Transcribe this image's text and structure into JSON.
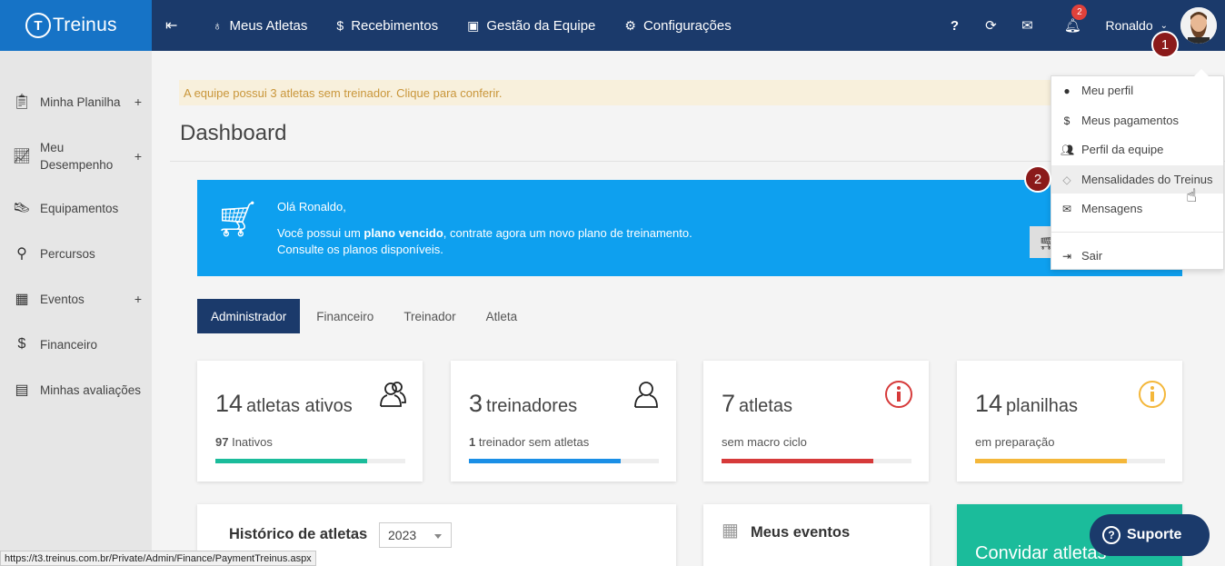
{
  "topbar": {
    "brand": "Treinus",
    "nav": [
      {
        "icon": "medal-icon",
        "label": "Meus Atletas"
      },
      {
        "icon": "dollar-icon",
        "label": "Recebimentos"
      },
      {
        "icon": "id-card-icon",
        "label": "Gestão da Equipe"
      },
      {
        "icon": "gears-icon",
        "label": "Configurações"
      }
    ],
    "help": "?",
    "notifications_count": "2",
    "user_name": "Ronaldo"
  },
  "sidebar": {
    "items": [
      {
        "label": "Minha Planilha",
        "plus": "+"
      },
      {
        "label": "Meu Desempenho",
        "plus": "+"
      },
      {
        "label": "Equipamentos",
        "plus": ""
      },
      {
        "label": "Percursos",
        "plus": ""
      },
      {
        "label": "Eventos",
        "plus": "+"
      },
      {
        "label": "Financeiro",
        "plus": ""
      },
      {
        "label": "Minhas avaliações",
        "plus": ""
      }
    ]
  },
  "alert": "A equipe possui 3 atletas sem treinador. Clique para conferir.",
  "page_title": "Dashboard",
  "banner": {
    "greeting": "Olá Ronaldo,",
    "line2_prefix": "Você possui um ",
    "line2_bold": "plano vencido",
    "line2_suffix": ", contrate agora um novo plano de treinamento.",
    "line3": "Consulte os planos disponíveis."
  },
  "tabs": [
    "Administrador",
    "Financeiro",
    "Treinador",
    "Atleta"
  ],
  "cards": [
    {
      "number": "14",
      "unit": "atletas ativos",
      "sub_bold": "97",
      "sub": " Inativos",
      "fill_fraction": 0.8,
      "color": "#1bbc9b"
    },
    {
      "number": "3",
      "unit": "treinadores",
      "sub_bold": "1",
      "sub": " treinador sem atletas",
      "fill_fraction": 0.8,
      "color": "#1a8fe6"
    },
    {
      "number": "7",
      "unit": "atletas",
      "sub_bold": "",
      "sub": "sem macro ciclo",
      "fill_fraction": 0.8,
      "color": "#d63a3a"
    },
    {
      "number": "14",
      "unit": "planilhas",
      "sub_bold": "",
      "sub": "em preparação",
      "fill_fraction": 0.8,
      "color": "#f4b73a"
    }
  ],
  "history": {
    "title": "Histórico de atletas",
    "year": "2023"
  },
  "events": {
    "title": "Meus eventos"
  },
  "invite": {
    "title": "Convidar atletas"
  },
  "support": "Suporte",
  "status_url": "https://t3.treinus.com.br/Private/Admin/Finance/PaymentTreinus.aspx",
  "dropdown": {
    "items": [
      {
        "icon": "user-icon",
        "label": "Meu perfil"
      },
      {
        "icon": "dollar-icon",
        "label": "Meus pagamentos"
      },
      {
        "icon": "users-icon",
        "label": "Perfil da equipe"
      },
      {
        "icon": "tag-icon",
        "label": "Mensalidades do Treinus"
      },
      {
        "icon": "envelope-icon",
        "label": "Mensagens"
      },
      {
        "icon": "sign-out-icon",
        "label": "Sair"
      }
    ]
  },
  "steps": [
    "1",
    "2"
  ]
}
